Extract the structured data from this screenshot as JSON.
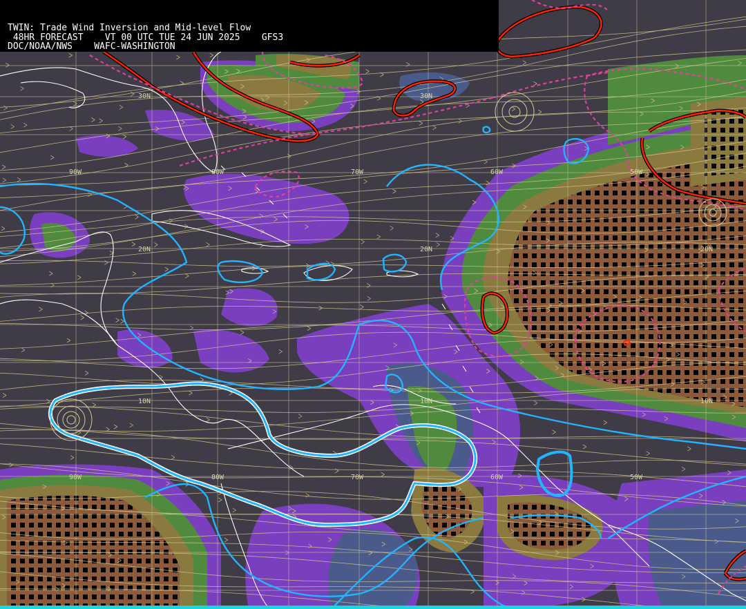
{
  "header": {
    "title": "TWIN: Trade Wind Inversion and Mid-level Flow",
    "forecast_line": " 48HR FORECAST    VT 00 UTC TUE 24 JUN 2025    GFS3",
    "agency_line": "DOC/NOAA/NWS    WAFC-WASHINGTON"
  },
  "grid_labels": {
    "lon_top": [
      "90W",
      "80W",
      "70W",
      "60W",
      "50W"
    ],
    "lon_bottom": [
      "90W",
      "80W",
      "70W",
      "60W",
      "50W"
    ],
    "lat_30": [
      "30N",
      "30N"
    ],
    "lat_20": [
      "20N",
      "20N",
      "20N"
    ],
    "lat_10": [
      "10N",
      "10N",
      "10N"
    ]
  },
  "colors": {
    "background": "#3f3b47",
    "purple": "#7a3fbf",
    "slate": "#4a5a8a",
    "green": "#4f8a3f",
    "olive": "#8a7a3f",
    "brown": "#8a5a3a",
    "cyan_contour": "#22b4ff",
    "red_contour": "#ff2200",
    "magenta_contour": "#e0409a",
    "streamline": "#d8cc90",
    "coast": "#ffffff",
    "grid": "#d8d2a8"
  }
}
